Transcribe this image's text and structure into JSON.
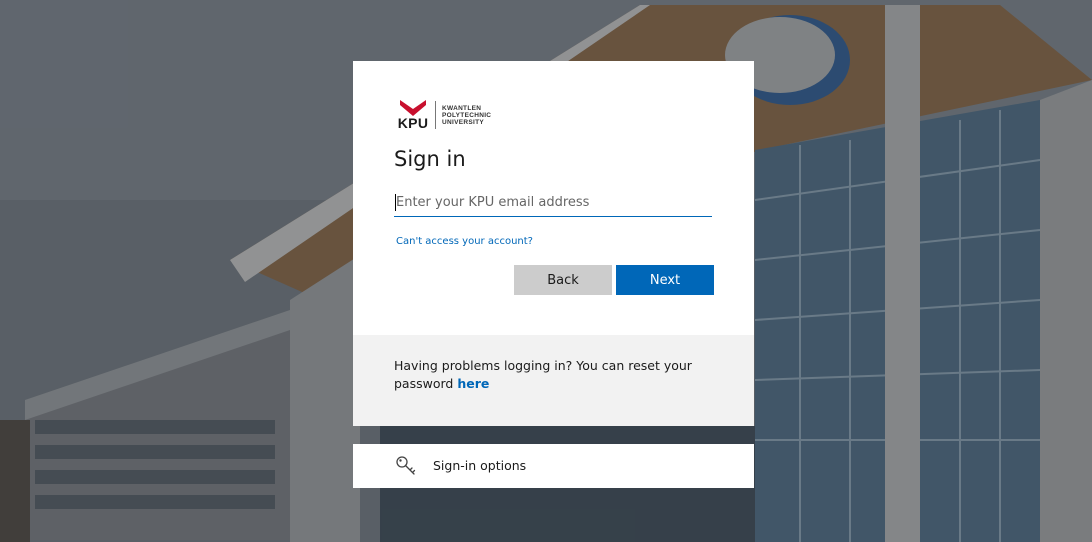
{
  "background": {
    "scene": "campus-building-photo",
    "overlay_color": "#282828"
  },
  "logo": {
    "short": "KPU",
    "line1": "KWANTLEN",
    "line2": "POLYTECHNIC",
    "line3": "UNIVERSITY",
    "brand_color": "#c8102e"
  },
  "signin": {
    "title": "Sign in",
    "email_placeholder": "Enter your KPU email address",
    "email_value": "",
    "cant_access_link": "Can't access your account?",
    "back_label": "Back",
    "next_label": "Next",
    "accent_color": "#0067b8"
  },
  "help": {
    "text": "Having problems logging in? You can reset your password ",
    "link": "here"
  },
  "options": {
    "icon": "key-icon",
    "label": "Sign-in options"
  }
}
